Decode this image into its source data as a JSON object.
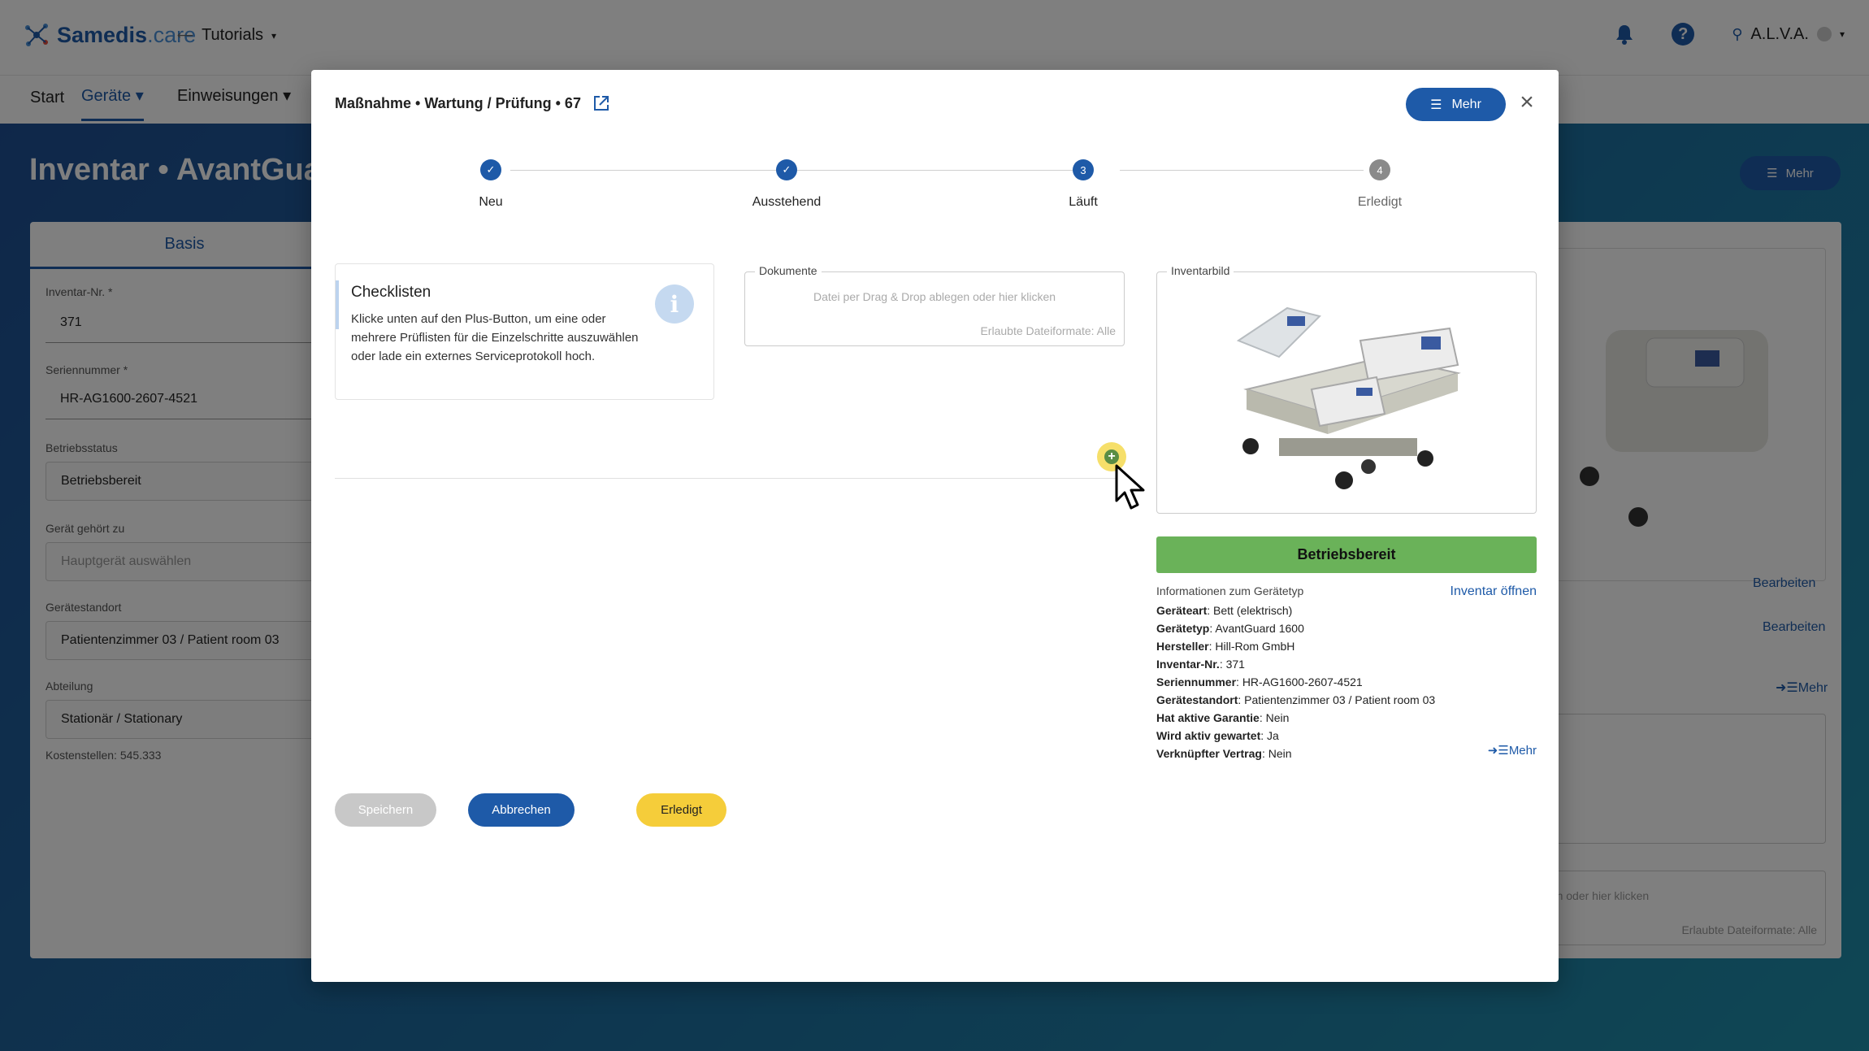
{
  "app": {
    "logo": "Samedis",
    "logo_suffix": ".care",
    "tutorials": "Tutorials",
    "user": "A.L.V.A.",
    "nav": {
      "start": "Start",
      "geraete": "Geräte",
      "einweisungen": "Einweisungen"
    }
  },
  "page": {
    "title": "Inventar • AvantGuard",
    "mehr": "Mehr",
    "tab": "Basis",
    "fields": {
      "inventar_nr_label": "Inventar-Nr. *",
      "inventar_nr": "371",
      "seriennummer_label": "Seriennummer *",
      "seriennummer": "HR-AG1600-2607-4521",
      "betriebsstatus_label": "Betriebsstatus",
      "betriebsstatus": "Betriebsbereit",
      "geraet_gehoert_label": "Gerät gehört zu",
      "geraet_gehoert_placeholder": "Hauptgerät auswählen",
      "standort_label": "Gerätestandort",
      "standort": "Patientenzimmer 03 / Patient room 03",
      "abteilung_label": "Abteilung",
      "abteilung": "Stationär / Stationary",
      "kostenstellen": "Kostenstellen: 545.333"
    },
    "bearbeiten": "Bearbeiten",
    "mehr_link": "Mehr",
    "drop_hint_partial": "gen oder hier klicken",
    "formats": "Erlaubte Dateiformate: Alle"
  },
  "modal": {
    "title": "Maßnahme • Wartung / Prüfung • 67",
    "mehr": "Mehr",
    "steps": [
      {
        "label": "Neu",
        "state": "done",
        "num": ""
      },
      {
        "label": "Ausstehend",
        "state": "done",
        "num": ""
      },
      {
        "label": "Läuft",
        "state": "active",
        "num": "3"
      },
      {
        "label": "Erledigt",
        "state": "pending",
        "num": "4"
      }
    ],
    "checklist": {
      "title": "Checklisten",
      "text": "Klicke unten auf den Plus-Button, um eine oder mehrere Prüflisten für die Einzelschritte auszuwählen oder lade ein externes Serviceprotokoll hoch."
    },
    "documents": {
      "legend": "Dokumente",
      "hint": "Datei per Drag & Drop ablegen oder hier klicken",
      "formats": "Erlaubte Dateiformate: Alle"
    },
    "inventarbild": "Inventarbild",
    "status": "Betriebsbereit",
    "info_head": "Informationen zum Gerätetyp",
    "inventar_oeffnen": "Inventar öffnen",
    "info": [
      {
        "k": "Geräteart",
        "v": ": Bett (elektrisch)"
      },
      {
        "k": "Gerätetyp",
        "v": ": AvantGuard 1600"
      },
      {
        "k": "Hersteller",
        "v": ": Hill-Rom GmbH"
      },
      {
        "k": "Inventar-Nr.",
        "v": ": 371"
      },
      {
        "k": "Seriennummer",
        "v": ": HR-AG1600-2607-4521"
      },
      {
        "k": "Gerätestandort",
        "v": ": Patientenzimmer 03 / Patient room 03"
      },
      {
        "k": "Hat aktive Garantie",
        "v": ": Nein"
      },
      {
        "k": "Wird aktiv gewartet",
        "v": ": Ja"
      },
      {
        "k": "Verknüpfter Vertrag",
        "v": ": Nein"
      }
    ],
    "mehr_link": "Mehr",
    "buttons": {
      "save": "Speichern",
      "cancel": "Abbrechen",
      "done": "Erledigt"
    }
  },
  "colors": {
    "primary": "#1e5aa8",
    "success": "#6ab259",
    "warning": "#f5cd3a"
  }
}
